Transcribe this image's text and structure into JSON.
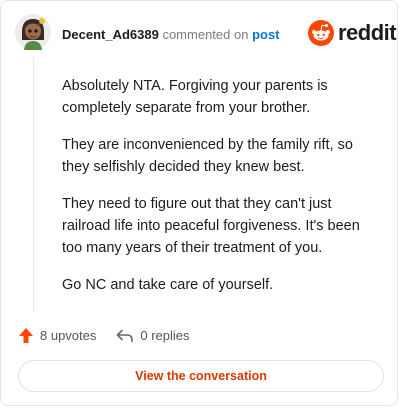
{
  "comment": {
    "username": "Decent_Ad6389",
    "commented_on_text": "commented on",
    "post_link_text": "post",
    "paragraphs": [
      "Absolutely NTA. Forgiving your parents is completely separate from your brother.",
      "They are inconvenienced by the family rift, so they selfishly decided they knew best.",
      "They need to figure out that they can't just railroad life into peaceful forgiveness. It's been too many years of their treatment of you.",
      "Go NC and take care of yourself."
    ]
  },
  "brand": {
    "name": "reddit",
    "color": "#ff4500",
    "icon": "reddit-snoo-icon"
  },
  "actions": {
    "upvotes_label": "8 upvotes",
    "replies_label": "0 replies",
    "upvote_icon": "upvote-arrow-icon",
    "reply_icon": "reply-arrow-icon",
    "upvote_color": "#ff4500"
  },
  "cta": {
    "label": "View the conversation",
    "color": "#d93a00"
  }
}
